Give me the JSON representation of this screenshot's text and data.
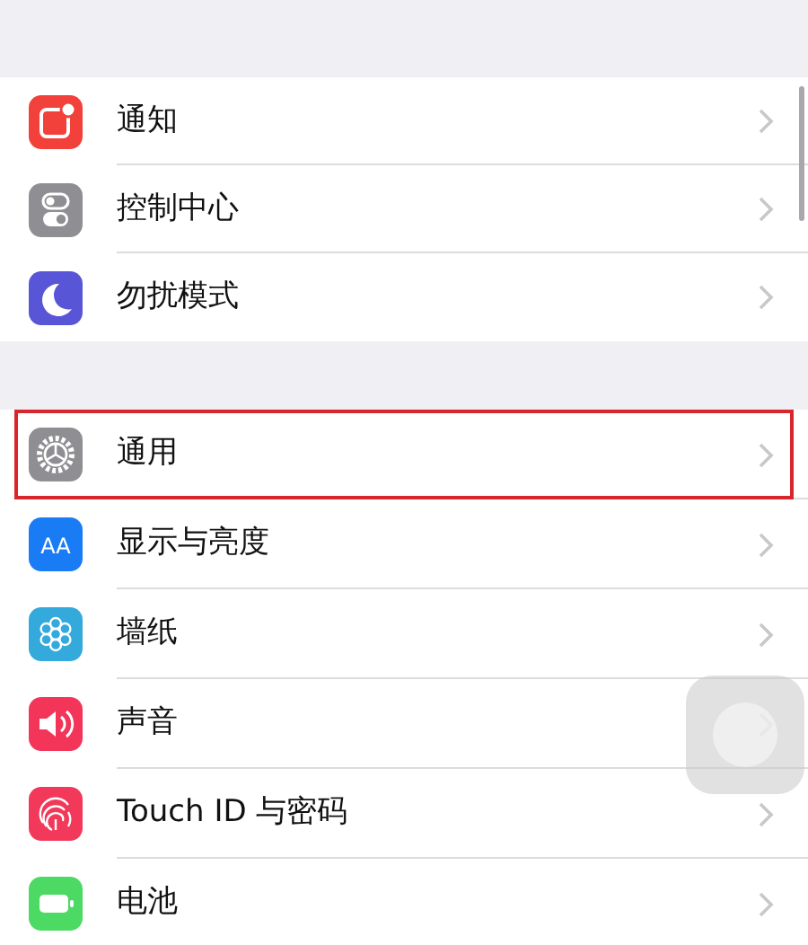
{
  "groups": [
    {
      "items": [
        {
          "label": "通知",
          "kind": "notifications",
          "highlighted": false
        },
        {
          "label": "控制中心",
          "kind": "switches",
          "highlighted": false
        },
        {
          "label": "勿扰模式",
          "kind": "moon",
          "highlighted": false
        }
      ]
    },
    {
      "items": [
        {
          "label": "通用",
          "kind": "gear",
          "highlighted": true
        },
        {
          "label": "显示与亮度",
          "kind": "textsize",
          "icon_text": "AA",
          "highlighted": false
        },
        {
          "label": "墙纸",
          "kind": "flower",
          "highlighted": false
        },
        {
          "label": "声音",
          "kind": "speaker",
          "highlighted": false
        },
        {
          "label": "Touch ID 与密码",
          "kind": "fingerprint",
          "highlighted": false
        },
        {
          "label": "电池",
          "kind": "battery",
          "highlighted": false
        }
      ]
    }
  ]
}
